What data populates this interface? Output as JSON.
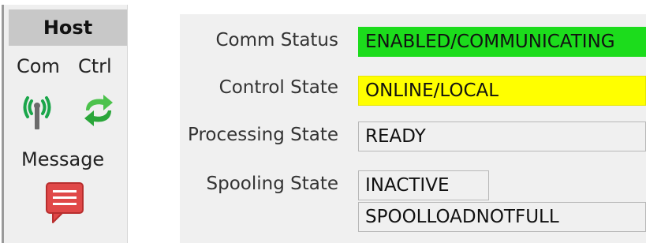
{
  "host": {
    "title": "Host",
    "com_label": "Com",
    "ctrl_label": "Ctrl",
    "message_label": "Message",
    "icons": {
      "com": "antenna-signal-icon",
      "ctrl": "refresh-arrows-icon",
      "message": "message-bubble-icon"
    }
  },
  "status": {
    "comm_status": {
      "label": "Comm Status",
      "value": "ENABLED/COMMUNICATING",
      "color": "#1cdc1c"
    },
    "control_state": {
      "label": "Control State",
      "value": "ONLINE/LOCAL",
      "color": "#ffff00"
    },
    "processing_state": {
      "label": "Processing State",
      "value": "READY"
    },
    "spooling_state": {
      "label": "Spooling State",
      "value": "INACTIVE",
      "secondary_value": "SPOOLLOADNOTFULL"
    }
  }
}
